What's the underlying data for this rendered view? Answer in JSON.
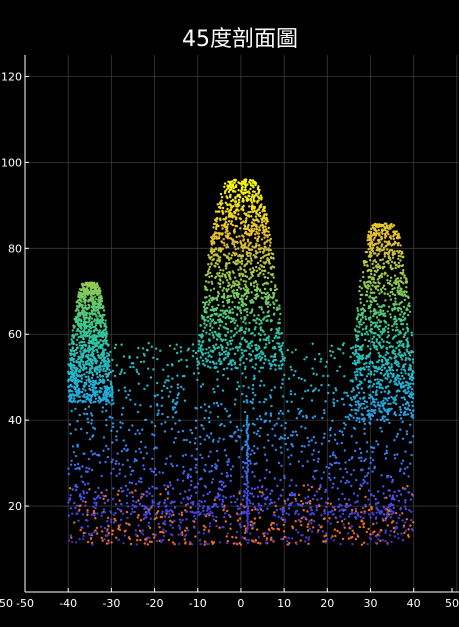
{
  "chart_data": {
    "type": "scatter",
    "title": "45度剖面圖",
    "xlabel": "",
    "ylabel": "",
    "xlim": [
      -55,
      50
    ],
    "ylim": [
      0,
      125
    ],
    "xticks": [
      -50,
      -40,
      -30,
      -20,
      -10,
      0,
      10,
      20,
      30,
      40,
      50
    ],
    "yticks": [
      20,
      40,
      60,
      80,
      100,
      120
    ],
    "extra_x_tick_label": "-50",
    "grid": true,
    "background": "#000000",
    "colormap": "parula",
    "colormap_range": [
      10,
      95
    ],
    "ground_color": "#f06a2a",
    "ground_height_max": 26,
    "crowns": [
      {
        "x_center": -35,
        "x_width": 10,
        "y_top": 72,
        "y_bottom": 44
      },
      {
        "x_center": 0,
        "x_width": 16,
        "y_top": 96,
        "y_bottom": 52
      },
      {
        "x_center": 33,
        "x_width": 15,
        "y_top": 86,
        "y_bottom": 40
      }
    ],
    "understory": {
      "x_range": [
        -40,
        40
      ],
      "y_range": [
        18,
        58
      ]
    },
    "stem_x": 1.5,
    "stem_y_range": [
      14,
      41
    ]
  }
}
